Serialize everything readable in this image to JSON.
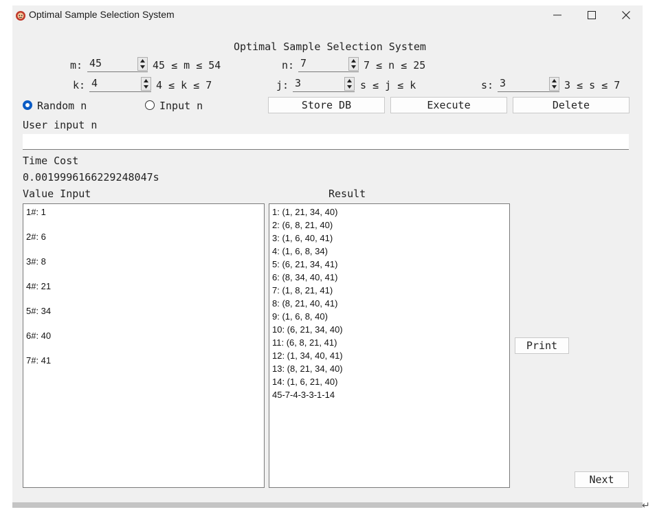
{
  "window": {
    "title": "Optimal Sample Selection System",
    "controls": [
      "minimize-icon",
      "maximize-icon",
      "close-icon"
    ]
  },
  "header": {
    "title": "Optimal Sample Selection System"
  },
  "params": {
    "m": {
      "label": "m:",
      "value": "45",
      "range": "45 ≤ m ≤ 54"
    },
    "n": {
      "label": "n:",
      "value": "7",
      "range": "7 ≤ n ≤ 25"
    },
    "k": {
      "label": "k:",
      "value": "4",
      "range": "4 ≤ k ≤ 7"
    },
    "j": {
      "label": "j:",
      "value": "3",
      "range": "s ≤ j ≤ k"
    },
    "s": {
      "label": "s:",
      "value": "3",
      "range": "3 ≤ s ≤ 7"
    }
  },
  "mode": {
    "random_label": "Random n",
    "input_label": "Input n",
    "selected": "random"
  },
  "buttons": {
    "store_db": "Store DB",
    "execute": "Execute",
    "delete": "Delete",
    "print": "Print",
    "next": "Next"
  },
  "user_input": {
    "label": "User input n",
    "value": ""
  },
  "time_cost": {
    "label": "Time Cost",
    "value": "0.0019996166229248047s"
  },
  "value_input": {
    "label": "Value Input",
    "items": [
      "1#: 1",
      "2#: 6",
      "3#: 8",
      "4#: 21",
      "5#: 34",
      "6#: 40",
      "7#: 41"
    ]
  },
  "result": {
    "label": "Result",
    "items": [
      "1: (1, 21, 34, 40)",
      "2: (6, 8, 21, 40)",
      "3: (1, 6, 40, 41)",
      "4: (1, 6, 8, 34)",
      "5: (6, 21, 34, 41)",
      "6: (8, 34, 40, 41)",
      "7: (1, 8, 21, 41)",
      "8: (8, 21, 40, 41)",
      "9: (1, 6, 8, 40)",
      "10: (6, 21, 34, 40)",
      "11: (6, 8, 21, 41)",
      "12: (1, 34, 40, 41)",
      "13: (8, 21, 34, 40)",
      "14: (1, 6, 21, 40)",
      "45-7-4-3-3-1-14"
    ]
  },
  "colors": {
    "accent": "#0b5cc5",
    "window_bg": "#f0f0f0"
  }
}
